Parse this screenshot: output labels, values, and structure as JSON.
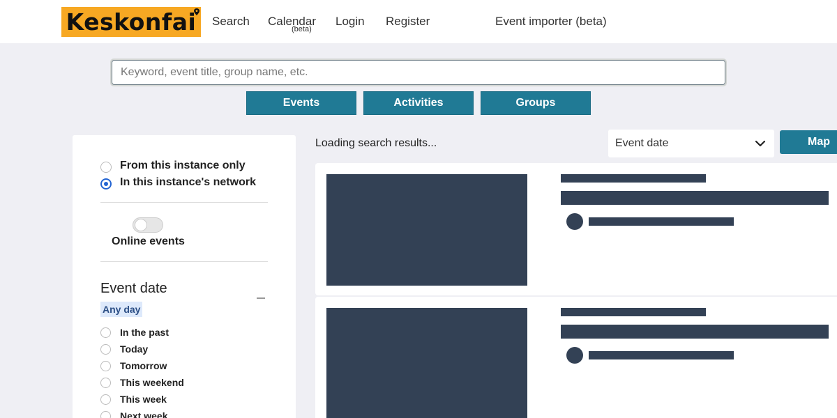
{
  "header": {
    "logo_text": "Keskonfai",
    "nav": {
      "search": "Search",
      "calendar": "Calendar",
      "calendar_badge": "(beta)",
      "login": "Login",
      "register": "Register",
      "importer": "Event importer (beta)"
    }
  },
  "search": {
    "placeholder": "Keyword, event title, group name, etc.",
    "value": ""
  },
  "type_buttons": {
    "events": "Events",
    "activities": "Activities",
    "groups": "Groups"
  },
  "sidebar": {
    "scope": {
      "options": [
        {
          "label": "From this instance only",
          "checked": false
        },
        {
          "label": "In this instance's network",
          "checked": true
        }
      ]
    },
    "online": {
      "label": "Online events",
      "enabled": false
    },
    "event_date": {
      "title": "Event date",
      "selected_badge": "Any day",
      "options": [
        "In the past",
        "Today",
        "Tomorrow",
        "This weekend",
        "This week",
        "Next week"
      ]
    }
  },
  "results": {
    "status": "Loading search results...",
    "sort_selected": "Event date",
    "map_button": "Map"
  },
  "colors": {
    "accent": "#207a95",
    "logo_bg": "#f7a823",
    "skeleton": "#334155",
    "radio_checked": "#2364d2"
  },
  "icons": [
    "map-pin-icon",
    "chevron-down-icon",
    "collapse-icon"
  ]
}
